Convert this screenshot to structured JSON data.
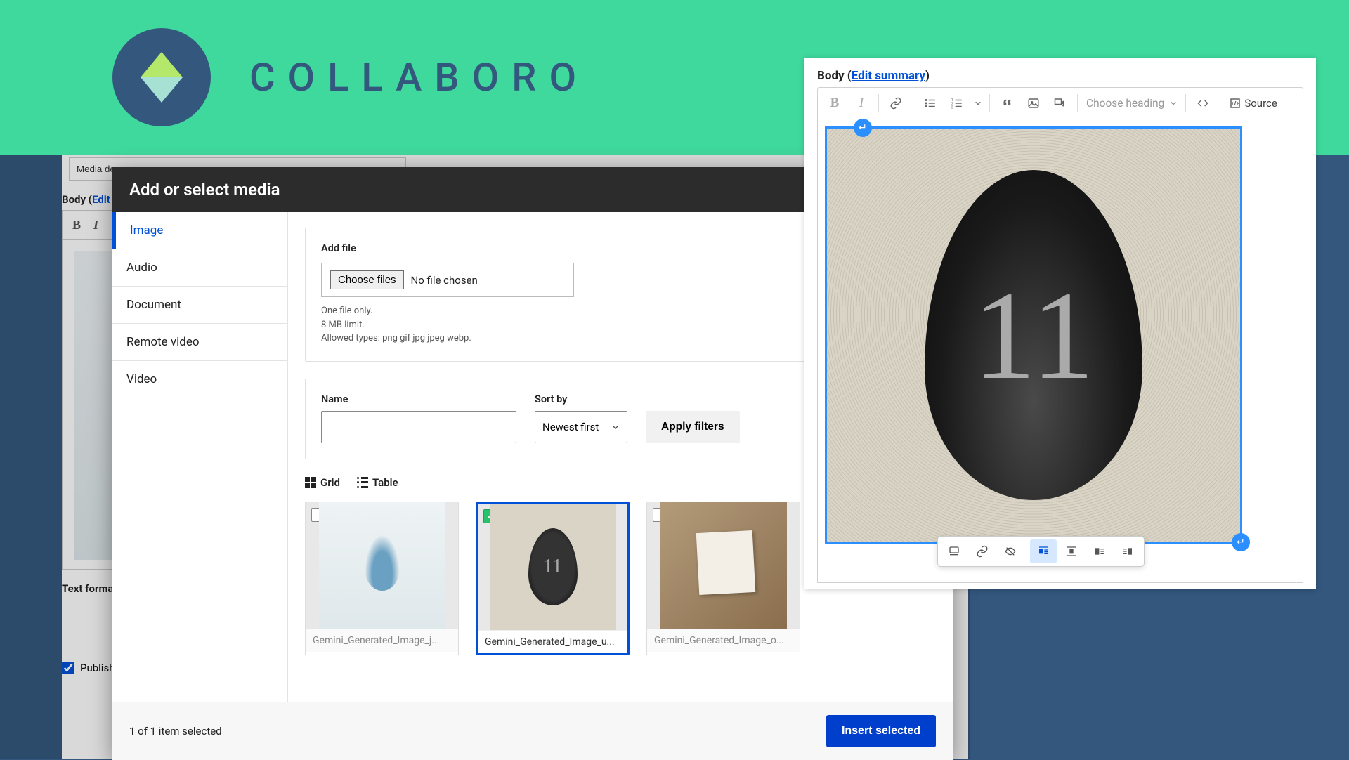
{
  "brand": "COLLABORO",
  "bg": {
    "title_value": "Media demo",
    "body_label": "Body",
    "edit": "Edit",
    "text_format": "Text forma",
    "publish": "Publish"
  },
  "modal": {
    "title": "Add or select media",
    "tabs": [
      "Image",
      "Audio",
      "Document",
      "Remote video",
      "Video"
    ],
    "active_tab": 0,
    "add_file": {
      "label": "Add file",
      "choose": "Choose files",
      "nofile": "No file chosen",
      "hint1": "One file only.",
      "hint2": "8 MB limit.",
      "hint3": "Allowed types: png gif jpg jpeg webp."
    },
    "filters": {
      "name_label": "Name",
      "sort_label": "Sort by",
      "sort_value": "Newest first",
      "apply": "Apply filters"
    },
    "view": {
      "grid": "Grid",
      "table": "Table"
    },
    "items": [
      {
        "caption": "Gemini_Generated_Image_j...",
        "selected": false
      },
      {
        "caption": "Gemini_Generated_Image_u...",
        "selected": true
      },
      {
        "caption": "Gemini_Generated_Image_o...",
        "selected": false
      }
    ],
    "footer": {
      "count": "1 of 1 item selected",
      "insert": "Insert selected"
    }
  },
  "editor": {
    "label_body": "Body",
    "edit_summary": "Edit summary",
    "heading_placeholder": "Choose heading",
    "source": "Source",
    "drop_number": "11"
  }
}
